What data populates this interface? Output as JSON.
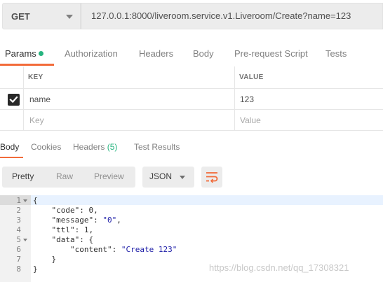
{
  "request": {
    "method": "GET",
    "url": "127.0.0.1:8000/liveroom.service.v1.Liveroom/Create?name=123"
  },
  "request_tabs": [
    {
      "label": "Params",
      "active": true,
      "indicator_color": "#26b47f"
    },
    {
      "label": "Authorization"
    },
    {
      "label": "Headers"
    },
    {
      "label": "Body"
    },
    {
      "label": "Pre-request Script"
    },
    {
      "label": "Tests"
    }
  ],
  "params": {
    "headers": {
      "key": "KEY",
      "value": "VALUE"
    },
    "rows": [
      {
        "checked": true,
        "key": "name",
        "value": "123"
      }
    ],
    "new_row": {
      "key_placeholder": "Key",
      "value_placeholder": "Value"
    }
  },
  "response_tabs": [
    {
      "label": "Body",
      "active": true
    },
    {
      "label": "Cookies"
    },
    {
      "label": "Headers",
      "count": "(5)"
    },
    {
      "label": "Test Results"
    }
  ],
  "view_modes": [
    "Pretty",
    "Raw",
    "Preview"
  ],
  "active_view_mode": "Pretty",
  "format": "JSON",
  "wrap_icon": "wrap-lines-icon",
  "code": {
    "line_numbers": [
      "1",
      "2",
      "3",
      "4",
      "5",
      "6",
      "7",
      "8"
    ],
    "lines": [
      [
        "{"
      ],
      [
        "    ",
        "\"code\"",
        ": ",
        "0",
        ","
      ],
      [
        "    ",
        "\"message\"",
        ": ",
        "\"0\"",
        ","
      ],
      [
        "    ",
        "\"ttl\"",
        ": ",
        "1",
        ","
      ],
      [
        "    ",
        "\"data\"",
        ": {"
      ],
      [
        "        ",
        "\"content\"",
        ": ",
        "\"Create 123\""
      ],
      [
        "    }"
      ],
      [
        "}"
      ]
    ]
  },
  "watermark": "https://blog.csdn.net/qq_17308321",
  "colors": {
    "accent": "#f26b3a",
    "success": "#26b47f"
  }
}
